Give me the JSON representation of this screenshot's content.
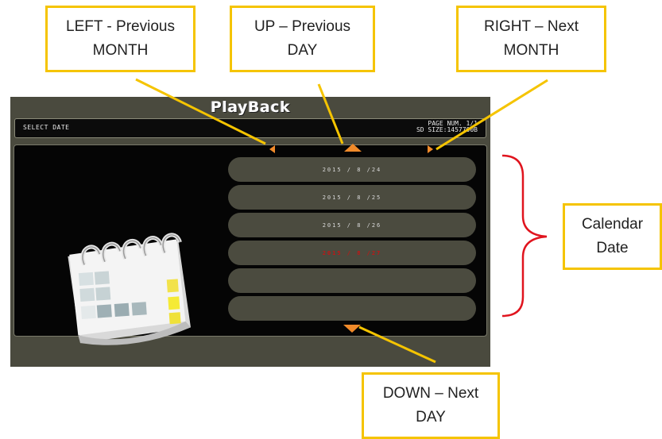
{
  "callouts": {
    "left": {
      "line1": "LEFT - Previous",
      "line2": "MONTH"
    },
    "up": {
      "line1": "UP – Previous",
      "line2": "DAY"
    },
    "right": {
      "line1": "RIGHT – Next",
      "line2": "MONTH"
    },
    "calendar": {
      "line1": "Calendar",
      "line2": "Date"
    },
    "down": {
      "line1": "DOWN – Next",
      "line2": "DAY"
    }
  },
  "screen": {
    "title": "PlayBack",
    "select_date_label": "SELECT DATE",
    "page_num": "PAGE NUM. 1/1",
    "sd_size": "SD SIZE:1457700B",
    "dates": [
      {
        "label": "2015 / 8 /24",
        "selected": false
      },
      {
        "label": "2015 / 8 /25",
        "selected": false
      },
      {
        "label": "2015 / 8 /26",
        "selected": false
      },
      {
        "label": "2015 / 8 /27",
        "selected": true
      },
      {
        "label": "",
        "selected": false
      },
      {
        "label": "",
        "selected": false
      }
    ]
  },
  "colors": {
    "callout_border": "#f5c400",
    "arrow": "#f08a2a",
    "brace": "#e0141e",
    "selected_date": "#c21616"
  },
  "icons": [
    "calendar-icon",
    "left-arrow-icon",
    "up-arrow-icon",
    "right-arrow-icon",
    "down-arrow-icon",
    "curly-brace-icon"
  ]
}
